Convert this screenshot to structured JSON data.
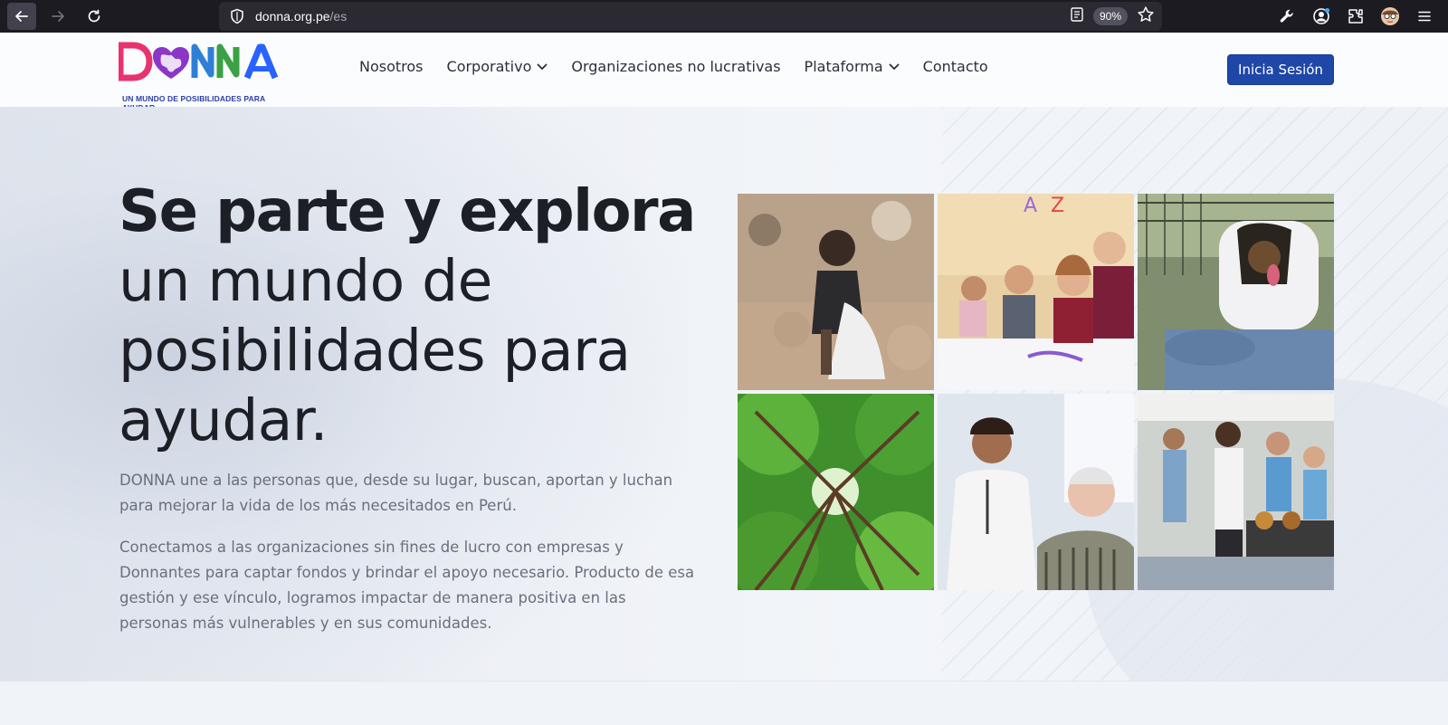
{
  "browser": {
    "url_domain": "donna.org.pe",
    "url_path": "/es",
    "zoom": "90%"
  },
  "site": {
    "logo_text": "DONNA",
    "logo_tagline": "UN MUNDO DE POSIBILIDADES PARA AYUDAR",
    "nav": [
      {
        "label": "Nosotros",
        "dropdown": false
      },
      {
        "label": "Corporativo",
        "dropdown": true
      },
      {
        "label": "Organizaciones no lucrativas",
        "dropdown": false
      },
      {
        "label": "Plataforma",
        "dropdown": true
      },
      {
        "label": "Contacto",
        "dropdown": false
      }
    ],
    "login_label": "Inicia Sesión"
  },
  "hero": {
    "title_bold": "Se parte y explora",
    "title_light_1": "un mundo de",
    "title_light_2": "posibilidades para",
    "title_light_3": "ayudar.",
    "paragraph_1": "DONNA une a las personas que, desde su lugar, buscan, aportan y luchan para mejorar la vida de los más necesitados en Perú.",
    "paragraph_2": "Conectamos a las organizaciones sin fines de lucro con empresas y Donnantes para captar fondos y brindar el apoyo necesario. Producto de esa gestión y ese vínculo, logramos impactar de manera positiva en las personas más vulnerables y en sus comunidades."
  },
  "colors": {
    "brand_blue": "#1e47a7",
    "logo_pink": "#e8336e",
    "logo_purple": "#8b35c9",
    "logo_green": "#3aa145",
    "logo_blue": "#2962ff"
  }
}
